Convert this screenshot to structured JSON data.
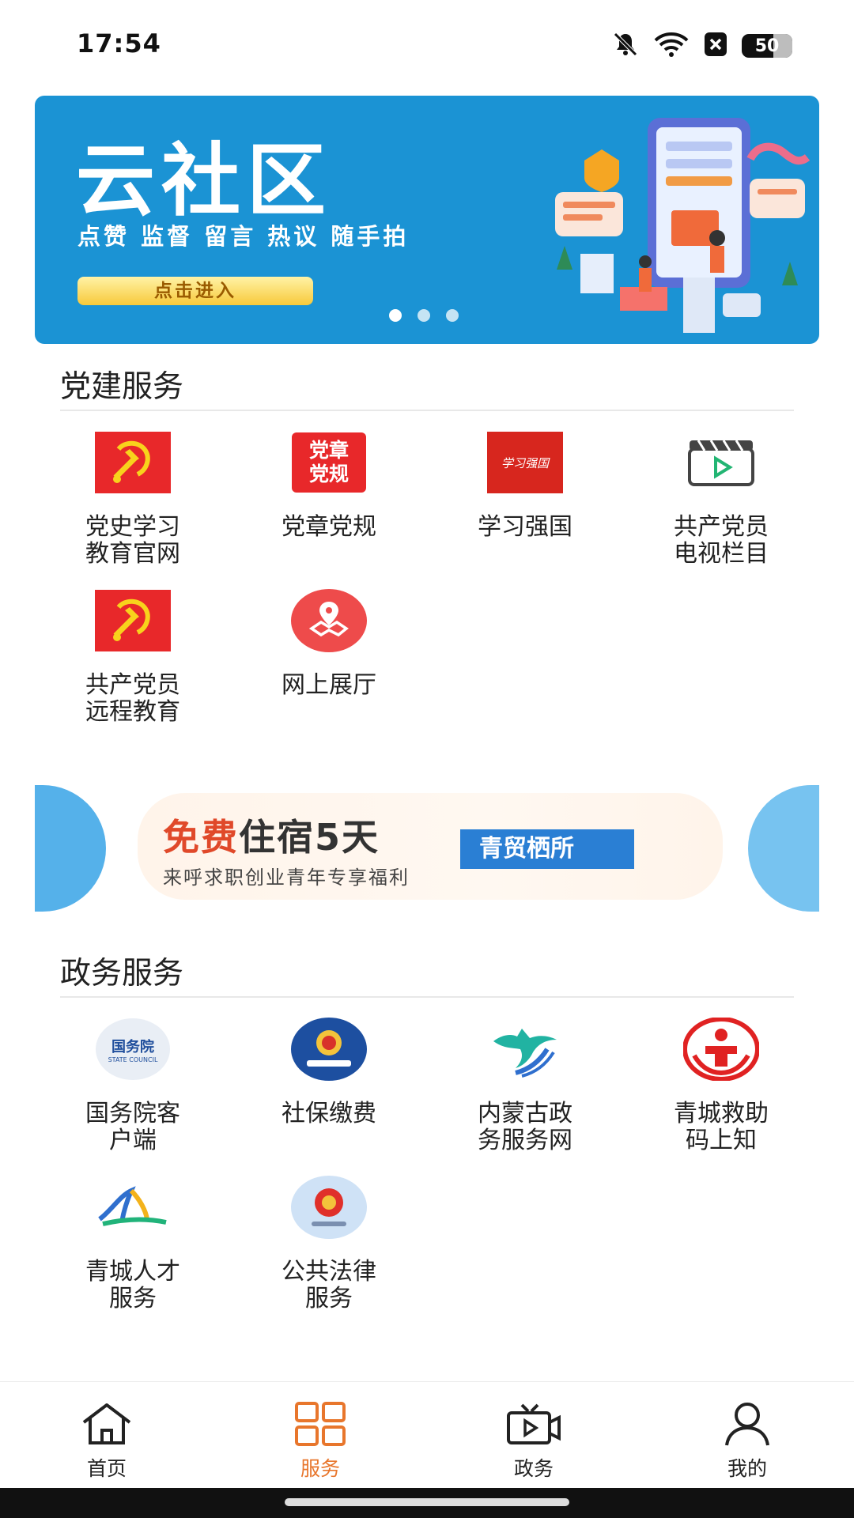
{
  "status_bar": {
    "time": "17:54",
    "battery": "50"
  },
  "top_banner": {
    "title": "云社区",
    "subtitle": "点赞 监督 留言 热议 随手拍",
    "button_label": "点击进入",
    "page_count": 3,
    "active_page": 0
  },
  "party_section": {
    "title": "党建服务",
    "items": [
      {
        "lines": [
          "党史学习",
          "教育官网"
        ],
        "icon": "party-flag-icon"
      },
      {
        "lines": [
          "党章党规"
        ],
        "icon": "party-constitution-icon",
        "icon_text": [
          "党章",
          "党规"
        ]
      },
      {
        "lines": [
          "学习强国"
        ],
        "icon": "xuexi-qiangguo-icon",
        "icon_text": [
          "学习强国"
        ]
      },
      {
        "lines": [
          "共产党员",
          "电视栏目"
        ],
        "icon": "video-clapboard-icon"
      },
      {
        "lines": [
          "共产党员",
          "远程教育"
        ],
        "icon": "party-flag-icon"
      },
      {
        "lines": [
          "网上展厅"
        ],
        "icon": "map-pin-icon"
      }
    ]
  },
  "promo_banner": {
    "headline_accent": "免费",
    "headline_rest": "住宿5天",
    "subline": "来呼求职创业青年专享福利",
    "tag": "青贸栖所"
  },
  "gov_section": {
    "title": "政务服务",
    "items": [
      {
        "lines": [
          "国务院客",
          "户端"
        ],
        "icon": "state-council-icon",
        "icon_text": [
          "国务院",
          "STATE COUNCIL"
        ]
      },
      {
        "lines": [
          "社保缴费"
        ],
        "icon": "tax-emblem-icon"
      },
      {
        "lines": [
          "内蒙古政",
          "务服务网"
        ],
        "icon": "horse-logo-icon"
      },
      {
        "lines": [
          "青城救助",
          "码上知"
        ],
        "icon": "relief-logo-icon"
      },
      {
        "lines": [
          "青城人才",
          "服务"
        ],
        "icon": "talent-logo-icon"
      },
      {
        "lines": [
          "公共法律",
          "服务"
        ],
        "icon": "legal-emblem-icon"
      }
    ]
  },
  "bottom_nav": {
    "tabs": [
      {
        "label": "首页",
        "icon": "home-icon"
      },
      {
        "label": "服务",
        "icon": "grid-icon",
        "active": true
      },
      {
        "label": "政务",
        "icon": "tv-icon"
      },
      {
        "label": "我的",
        "icon": "user-icon"
      }
    ]
  },
  "colors": {
    "accent": "#e8762c",
    "banner_blue": "#1b93d4",
    "party_red": "#e8282a"
  }
}
